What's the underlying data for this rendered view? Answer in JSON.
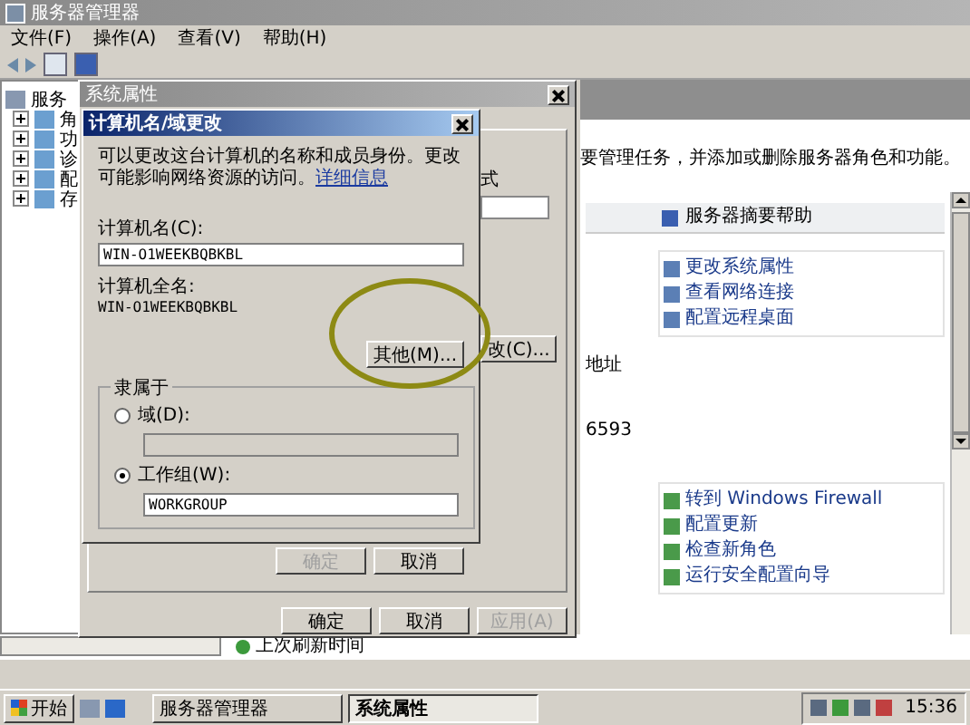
{
  "main_window": {
    "title": "服务器管理器",
    "menu": [
      "文件(F)",
      "操作(A)",
      "查看(V)",
      "帮助(H)"
    ],
    "tree": {
      "label": "服务",
      "expanded": true,
      "children": [
        {
          "label": "角",
          "expanded": false
        },
        {
          "label": "功",
          "expanded": false
        },
        {
          "label": "诊",
          "expanded": false
        },
        {
          "label": "配",
          "expanded": false
        },
        {
          "label": "存",
          "expanded": false
        }
      ]
    },
    "description": "要管理任务，并添加或删除服务器角色和功能。",
    "help_header": "服务器摘要帮助",
    "links_top": [
      "更改系统属性",
      "查看网络连接",
      "配置远程桌面"
    ],
    "address_label": "地址",
    "partial_value": "6593",
    "links_bottom": [
      "转到 Windows Firewall",
      "配置更新",
      "检查新角色",
      "运行安全配置向导"
    ],
    "refresh_text": "上次刷新时间"
  },
  "system_properties": {
    "title": "系统属性",
    "partial_label": "式",
    "partial_button": "改(C)...",
    "buttons": [
      {
        "label": "确定",
        "disabled": false
      },
      {
        "label": "取消",
        "disabled": false
      },
      {
        "label": "应用(A)",
        "disabled": true
      }
    ]
  },
  "name_dialog": {
    "title": "计算机名/域更改",
    "description": "可以更改这台计算机的名称和成员身份。更改可能影响网络资源的访问。",
    "link": "详细信息",
    "name_label": "计算机名(C):",
    "name_value": "WIN-O1WEEKBQBKBL",
    "full_name_label": "计算机全名:",
    "full_name_value": "WIN-O1WEEKBQBKBL",
    "more_button": "其他(M)...",
    "group_label": "隶属于",
    "options": [
      {
        "label": "域(D):",
        "selected": false
      },
      {
        "label": "工作组(W):",
        "selected": true,
        "value": "WORKGROUP"
      }
    ],
    "buttons": [
      {
        "label": "确定",
        "disabled": true
      },
      {
        "label": "取消",
        "disabled": false
      }
    ]
  },
  "taskbar": {
    "start": "开始",
    "tasks": [
      {
        "label": "服务器管理器",
        "selected": false
      },
      {
        "label": "系统属性",
        "selected": true
      }
    ],
    "clock": "15:36"
  }
}
